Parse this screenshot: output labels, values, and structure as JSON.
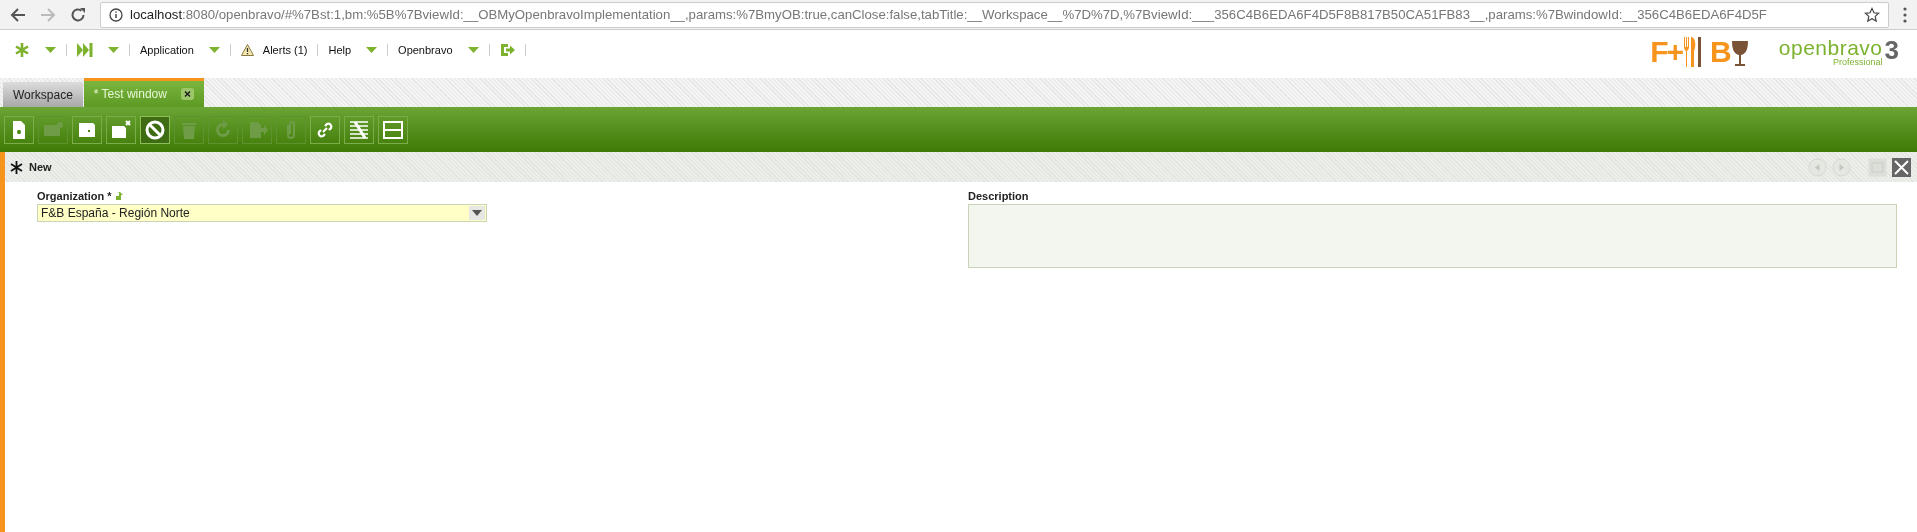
{
  "browser": {
    "url_host": "localhost",
    "url_path": ":8080/openbravo/#%7Bst:1,bm:%5B%7BviewId:__OBMyOpenbravoImplementation__,params:%7BmyOB:true,canClose:false,tabTitle:__Workspace__%7D%7D,%7BviewId:___356C4B6EDA6F4D5F8B817B50CA51FB83__,params:%7BwindowId:__356C4B6EDA6F4D5F"
  },
  "menu": [
    {
      "kind": "star",
      "dropdown": true
    },
    {
      "kind": "forward",
      "dropdown": true
    },
    {
      "kind": "text",
      "label": "Application",
      "dropdown": true
    },
    {
      "kind": "alert",
      "label": "Alerts (1)",
      "dropdown": false
    },
    {
      "kind": "text",
      "label": "Help",
      "dropdown": true
    },
    {
      "kind": "text",
      "label": "Openbravo",
      "dropdown": true
    },
    {
      "kind": "logout",
      "dropdown": false
    }
  ],
  "logos": {
    "fb_left": "F+",
    "fb_right": "B",
    "brand": "openbravo",
    "edition": "Professional",
    "version": "3"
  },
  "tabs": [
    {
      "label": "Workspace",
      "selected": false,
      "closable": false
    },
    {
      "label": "* Test window",
      "selected": true,
      "closable": true
    }
  ],
  "toolbar": [
    {
      "kind": "new",
      "disabled": false,
      "selected": false
    },
    {
      "kind": "grid",
      "disabled": true,
      "selected": false
    },
    {
      "kind": "save",
      "disabled": false,
      "selected": false
    },
    {
      "kind": "save-close",
      "disabled": false,
      "selected": false
    },
    {
      "kind": "cancel",
      "disabled": false,
      "selected": true
    },
    {
      "kind": "delete",
      "disabled": true,
      "selected": false
    },
    {
      "kind": "refresh",
      "disabled": true,
      "selected": false
    },
    {
      "kind": "export",
      "disabled": true,
      "selected": false
    },
    {
      "kind": "attach",
      "disabled": true,
      "selected": false
    },
    {
      "kind": "link",
      "disabled": false,
      "selected": false
    },
    {
      "kind": "tools",
      "disabled": false,
      "selected": false
    },
    {
      "kind": "layout",
      "disabled": false,
      "selected": false
    }
  ],
  "header": {
    "title": "New",
    "nav": [
      {
        "kind": "previous",
        "disabled": true
      },
      {
        "kind": "next",
        "disabled": true
      },
      {
        "kind": "maximize",
        "disabled": true
      },
      {
        "kind": "close",
        "disabled": false
      }
    ]
  },
  "form": {
    "organization": {
      "label": "Organization *",
      "value": "F&B España - Región Norte",
      "required": true
    },
    "description": {
      "label": "Description"
    }
  }
}
